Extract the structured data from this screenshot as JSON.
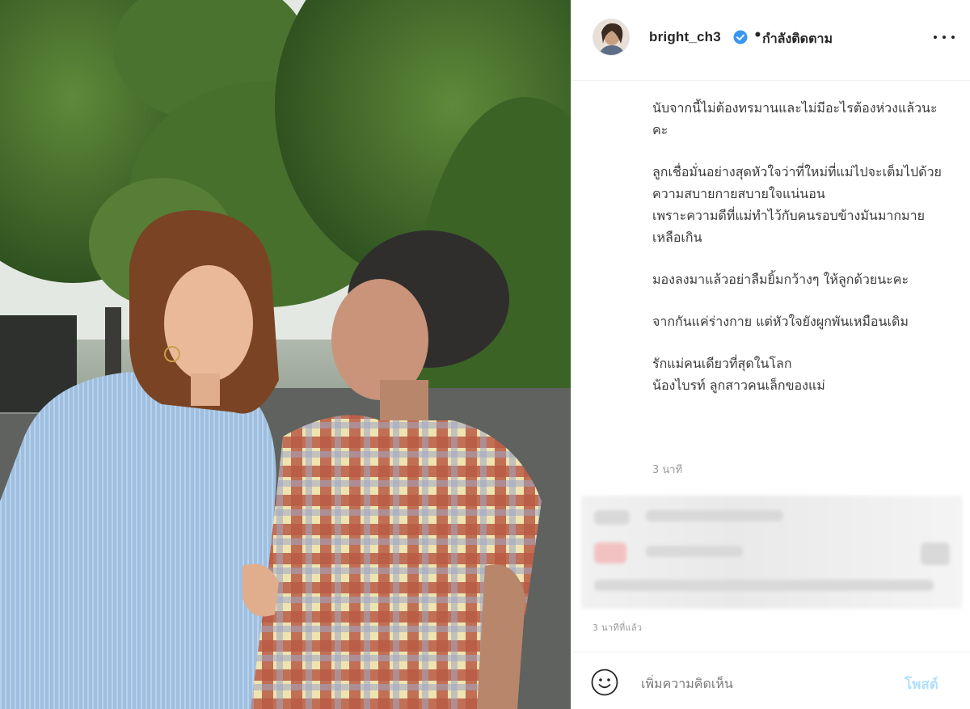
{
  "post": {
    "photo_alt": "",
    "author": {
      "username": "bright_ch3",
      "verified": true,
      "separator": "•",
      "follow_status": "กำลังติดตาม"
    },
    "caption": [
      "นับจากนี้ไม่ต้องทรมานและไม่มีอะไรต้องห่วงแล้วนะคะ",
      "ลูกเชื่อมั่นอย่างสุดหัวใจว่าที่ใหม่ที่แม่ไปจะเต็มไปด้วยความสบายกายสบายใจแน่นอน\nเพราะความดีที่แม่ทำไว้กับคนรอบข้างมันมากมายเหลือเกิน",
      "มองลงมาแล้วอย่าลืมยิ้มกว้างๆ ให้ลูกด้วยนะคะ",
      "จากกันแค่ร่างกาย แต่หัวใจยังผูกพันเหมือนเดิม",
      "รักแม่คนเดียวที่สุดในโลก\nน้องไบรท์ ลูกสาวคนเล็กของแม่"
    ],
    "caption_time": "3 นาที",
    "timestamp": "3 นาทีที่แล้ว"
  },
  "comment_box": {
    "placeholder": "เพิ่มความคิดเห็น",
    "post_label": "โพสต์"
  },
  "colors": {
    "verified_blue": "#3897f0",
    "post_disabled": "#b2dffc",
    "divider": "#efefef"
  },
  "icons": {
    "verified": "verified-badge-icon",
    "more": "more-options-icon",
    "emoji": "emoji-icon"
  }
}
